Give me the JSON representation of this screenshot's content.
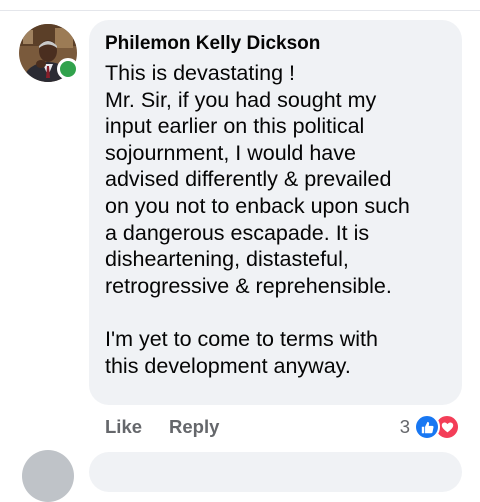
{
  "comment": {
    "author": "Philemon Kelly Dickson",
    "online": true,
    "text_lines": [
      "This is devastating !",
      "Mr. Sir, if you had sought my",
      "input earlier on this political",
      "sojournment, I would have",
      "advised differently & prevailed",
      "on you not to enback upon such",
      "a dangerous escapade. It is",
      "disheartening, distasteful,",
      "retrogressive & reprehensible.",
      "",
      "I'm yet to come to terms with",
      "this development anyway."
    ]
  },
  "actions": {
    "like_label": "Like",
    "reply_label": "Reply"
  },
  "reactions": {
    "count": "3",
    "icons": [
      "like-icon",
      "love-icon"
    ],
    "like_color": "#1877f2",
    "love_color": "#f33e58"
  },
  "colors": {
    "bubble": "#f0f2f5",
    "secondary_text": "#65676b",
    "online": "#31a24c"
  }
}
